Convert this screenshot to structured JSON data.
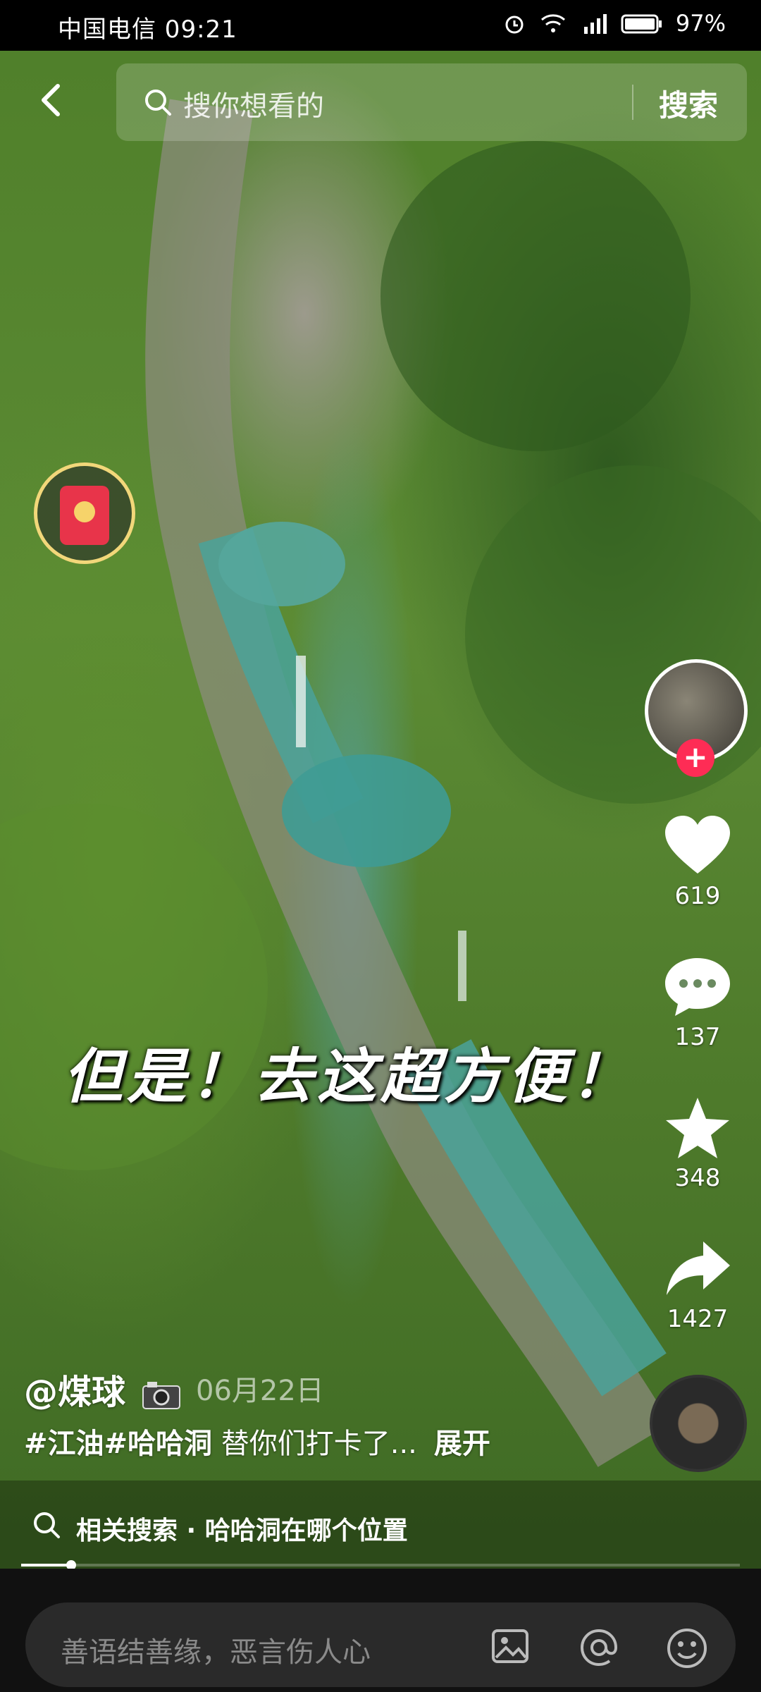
{
  "status_bar": {
    "carrier_time": "中国电信 09:21",
    "battery": "97%"
  },
  "search": {
    "placeholder": "搜你想看的",
    "button": "搜索"
  },
  "video": {
    "caption": "但是！去这超方便！"
  },
  "actions": {
    "likes": "619",
    "comments": "137",
    "favorites": "348",
    "shares": "1427"
  },
  "post": {
    "author": "@煤球",
    "date": "06月22日",
    "tags": "#江油#哈哈洞",
    "text": " 替你们打卡了...",
    "expand": "展开"
  },
  "related": {
    "label": "相关搜索 · 哈哈洞在哪个位置"
  },
  "playback": {
    "progress": 0.07
  },
  "comment": {
    "placeholder": "善语结善缘，恶言伤人心"
  },
  "colors": {
    "follow_accent": "#fe2c55",
    "red_packet": "#e8344a",
    "ring": "#f2d77a"
  },
  "icons": [
    "back-icon",
    "search-icon",
    "red-packet-icon",
    "heart-icon",
    "comment-icon",
    "star-icon",
    "share-icon",
    "camera-icon",
    "image-icon",
    "at-icon",
    "emoji-icon"
  ]
}
